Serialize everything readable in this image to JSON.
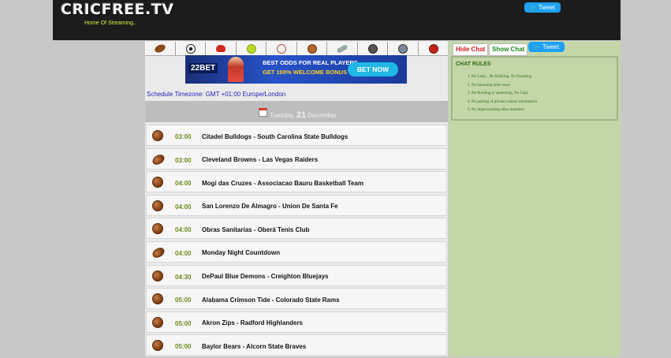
{
  "header": {
    "logo": "CRICFREE.TV",
    "tagline": "Home Of Streaming..",
    "tweet_label": "Tweet"
  },
  "sports": [
    "american-football",
    "soccer",
    "boxing",
    "tennis",
    "baseball",
    "basketball",
    "badminton",
    "rugby",
    "ice-hockey",
    "cricket"
  ],
  "banner": {
    "brand": "22BET",
    "line1": "BEST ODDS FOR REAL PLAYERS",
    "line2": "GET 100% WELCOME BONUS",
    "button": "BET NOW"
  },
  "schedule": {
    "timezone": "Schedule Timezone: GMT +01:00 Europe/London",
    "date_weekday": "Tuesday,",
    "date_day": "21",
    "date_month": "December"
  },
  "matches": [
    {
      "icon": "basketball-icon",
      "time": "03:00",
      "title": "Citadel Bulldogs - South Carolina State Bulldogs"
    },
    {
      "icon": "american-football-icon",
      "time": "03:00",
      "title": "Cleveland Browns - Las Vegas Raiders"
    },
    {
      "icon": "basketball-icon",
      "time": "04:00",
      "title": "Mogi das Cruzes - Associacao Bauru Basketball Team"
    },
    {
      "icon": "basketball-icon",
      "time": "04:00",
      "title": "San Lorenzo De Almagro - Union De Santa Fe"
    },
    {
      "icon": "basketball-icon",
      "time": "04:00",
      "title": "Obras Sanitarias - Oberá Tenis Club"
    },
    {
      "icon": "american-football-icon",
      "time": "04:00",
      "title": "Monday Night Countdown"
    },
    {
      "icon": "basketball-icon",
      "time": "04:30",
      "title": "DePaul Blue Demons - Creighton Bluejays"
    },
    {
      "icon": "basketball-icon",
      "time": "05:00",
      "title": "Alabama Crimson Tide - Colorado State Rams"
    },
    {
      "icon": "basketball-icon",
      "time": "05:00",
      "title": "Akron Zips - Radford Highlanders"
    },
    {
      "icon": "basketball-icon",
      "time": "05:00",
      "title": "Baylor Bears - Alcorn State Braves"
    }
  ],
  "chat": {
    "hide_label": "Hide Chat",
    "show_label": "Show Chat",
    "tweet_label": "Tweet",
    "rules_title": "CHAT RULES",
    "rules": [
      "No Links , No Bullying, No Swearing",
      "No harassing other users",
      "No flooding or spamming, No Caps",
      "No posting of private contact information",
      "No impersonating other members"
    ]
  },
  "colors": {
    "header_bg": "#1c1c1c",
    "tagline": "#d7ef3a",
    "chat_bg": "#c4d6a8",
    "time_green": "#6c8c1c",
    "timezone_blue": "#2424b8"
  }
}
